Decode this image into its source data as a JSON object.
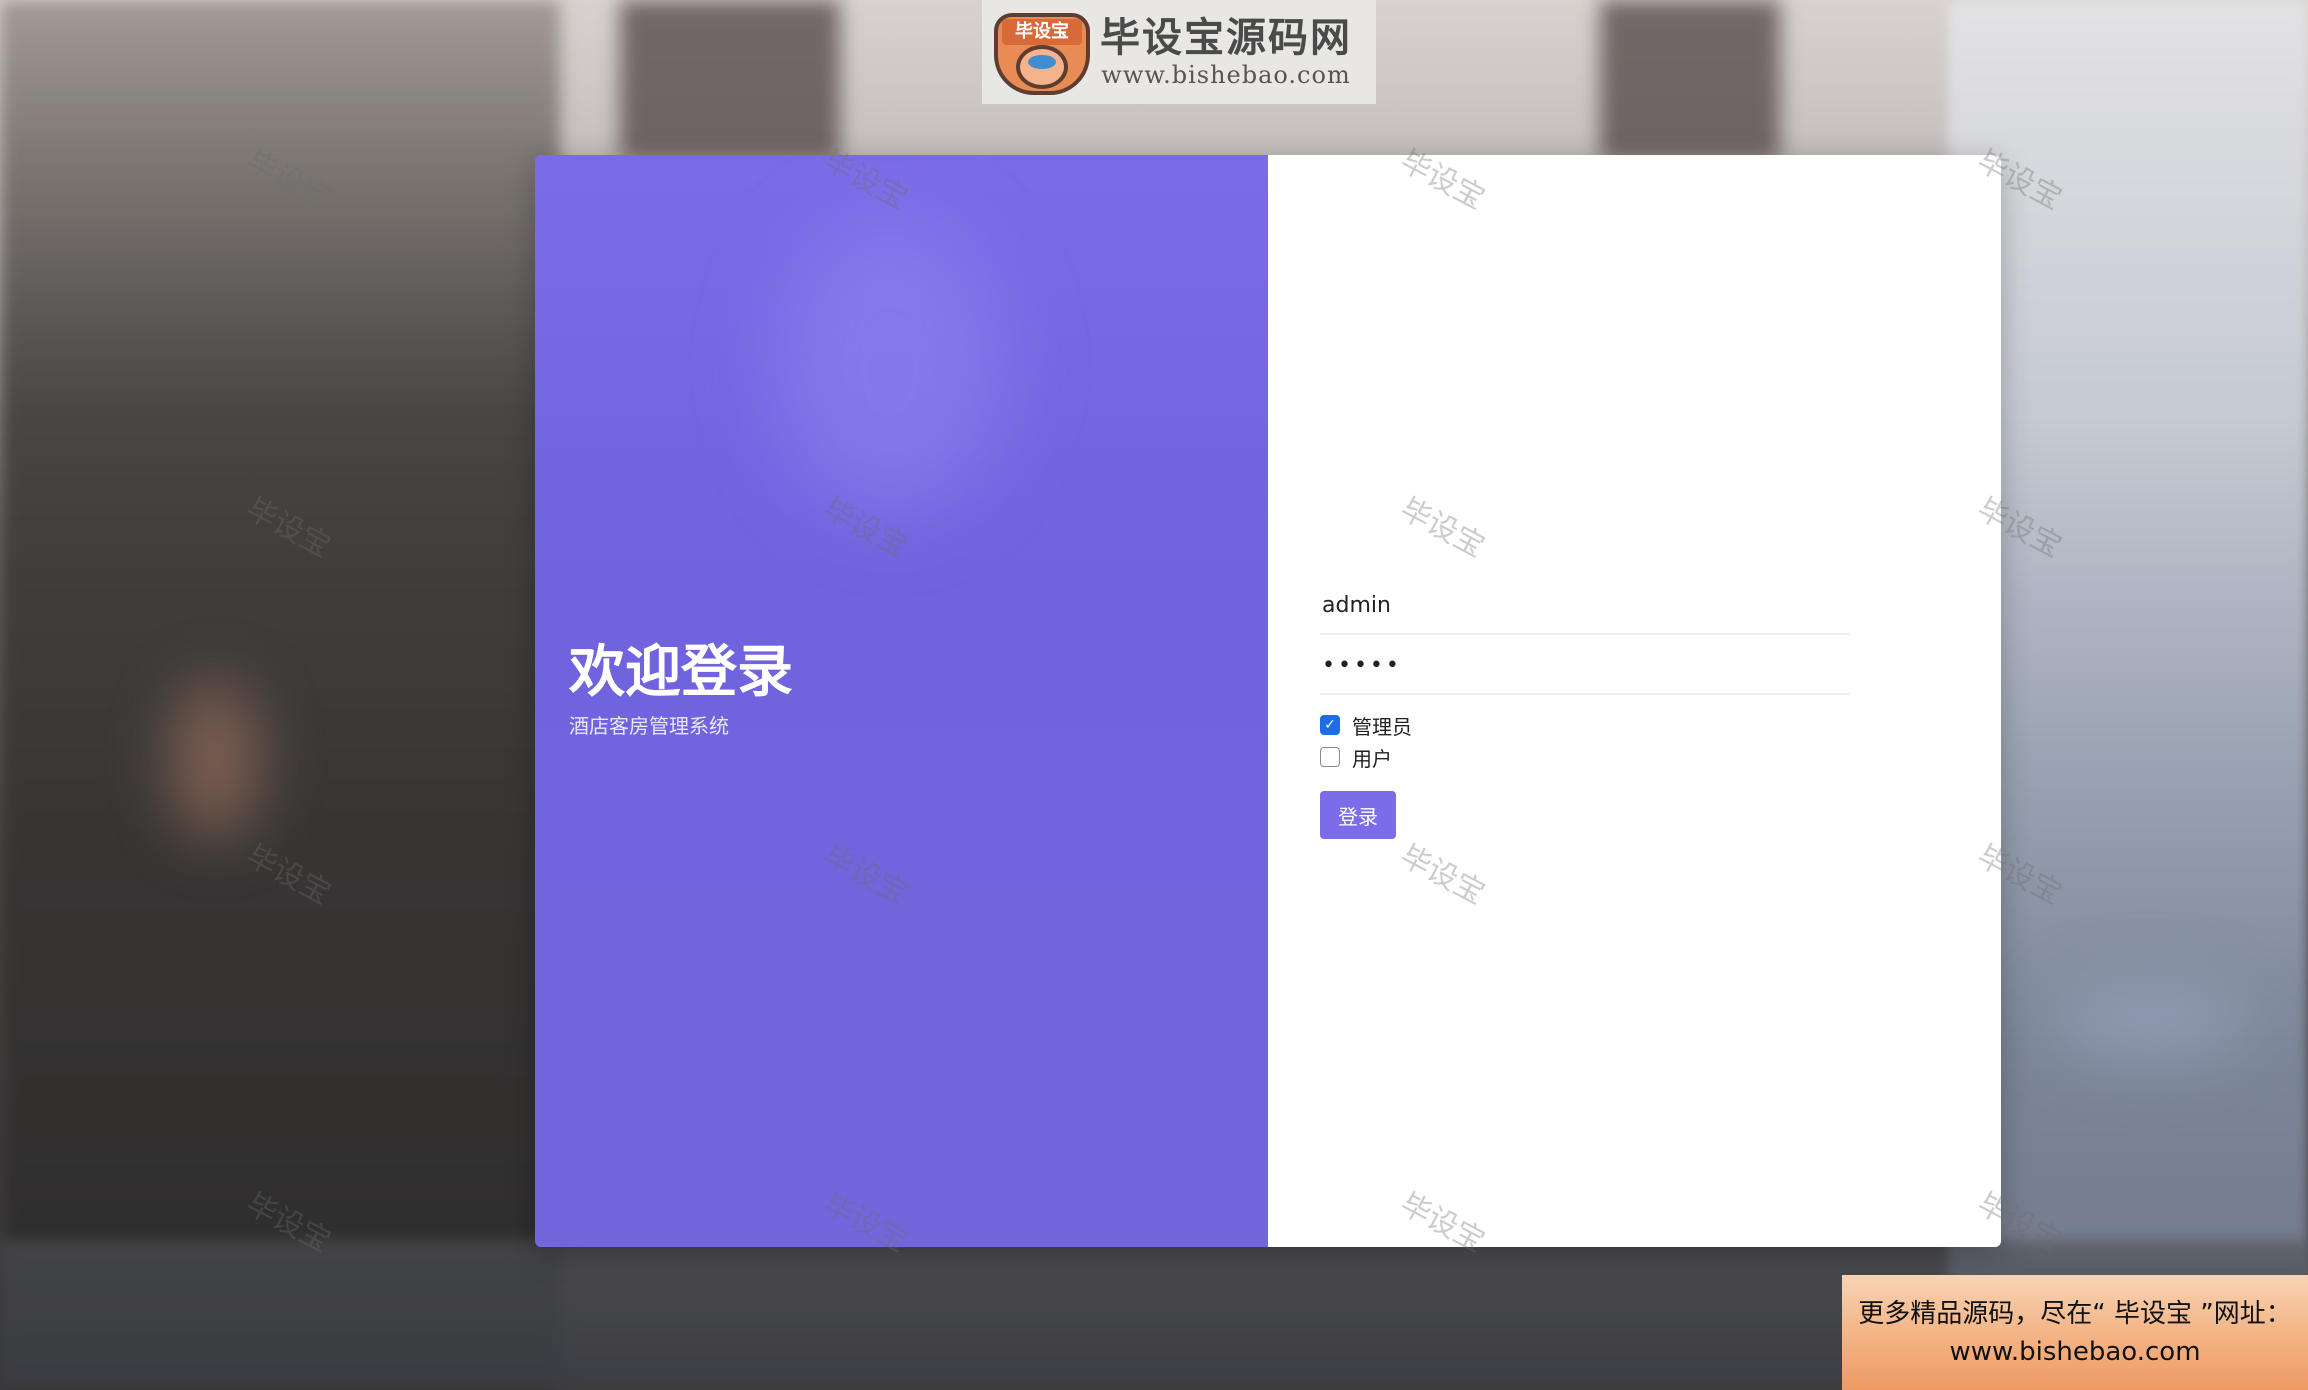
{
  "logo": {
    "emblem_text": "毕设宝",
    "title": "毕设宝源码网",
    "url": "www.bishebao.com"
  },
  "welcome": {
    "title": "欢迎登录",
    "subtitle": "酒店客房管理系统"
  },
  "login_form": {
    "username_value": "admin",
    "password_value": "•••••",
    "roles": [
      {
        "label": "管理员",
        "checked": true
      },
      {
        "label": "用户",
        "checked": false
      }
    ],
    "submit_label": "登录"
  },
  "watermark": {
    "text": "毕设宝"
  },
  "promo": {
    "line1": "更多精品源码，尽在“ 毕设宝 ”网址：",
    "line2": "www.bishebao.com"
  },
  "colors": {
    "left_panel": "#7067dc",
    "button": "#7b6cea",
    "checkbox_checked": "#1a6fe8"
  },
  "icons": {
    "checkbox_checked": "checkmark-icon"
  }
}
